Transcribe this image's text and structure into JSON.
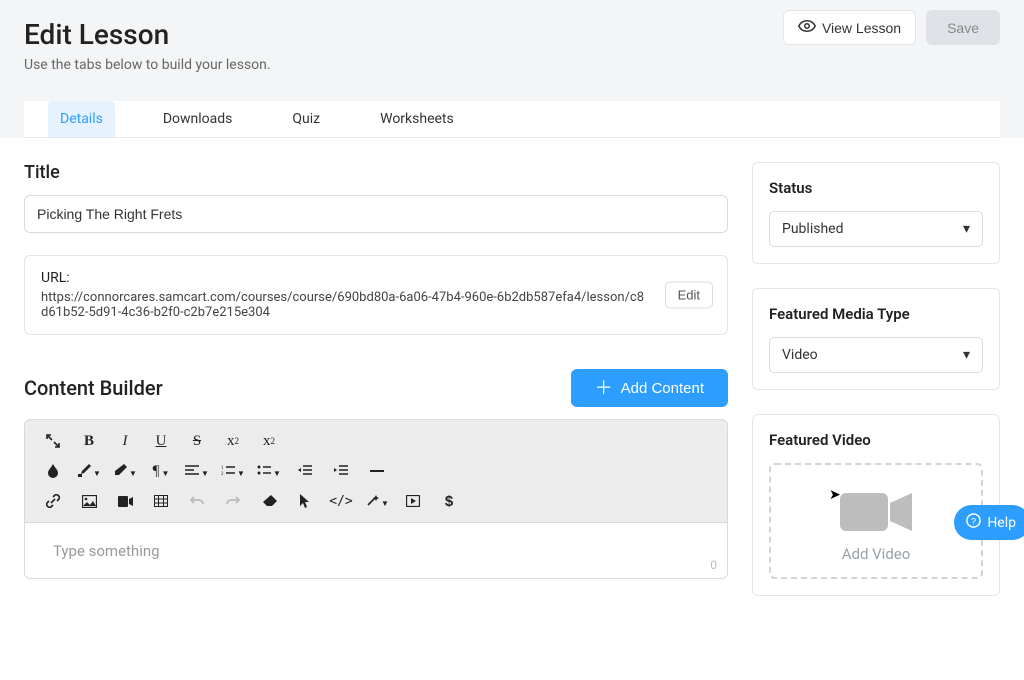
{
  "header": {
    "title": "Edit Lesson",
    "subtitle": "Use the tabs below to build your lesson.",
    "view_label": "View Lesson",
    "save_label": "Save"
  },
  "tabs": {
    "details": "Details",
    "downloads": "Downloads",
    "quiz": "Quiz",
    "worksheets": "Worksheets"
  },
  "title_section": {
    "label": "Title",
    "value": "Picking The Right Frets"
  },
  "url_section": {
    "label": "URL:",
    "value": "https://connorcares.samcart.com/courses/course/690bd80a-6a06-47b4-960e-6b2db587efa4/lesson/c8d61b52-5d91-4c36-b2f0-c2b7e215e304",
    "edit_label": "Edit"
  },
  "builder": {
    "title": "Content Builder",
    "add_label": "Add Content",
    "placeholder": "Type something",
    "char_count": "0"
  },
  "status_card": {
    "title": "Status",
    "selected": "Published"
  },
  "media_card": {
    "title": "Featured Media Type",
    "selected": "Video"
  },
  "video_card": {
    "title": "Featured Video",
    "drop_label": "Add Video"
  },
  "help": {
    "label": "Help"
  },
  "toolbar_icons": {
    "expand": "expand-icon",
    "bold": "bold-icon",
    "italic": "italic-icon",
    "underline": "underline-icon",
    "strike": "strike-icon",
    "sub": "subscript-icon",
    "sup": "superscript-icon",
    "ink": "ink-drop-icon",
    "brush": "brush-icon",
    "eraser-style": "clear-format-icon",
    "paragraph": "paragraph-icon",
    "align": "align-icon",
    "ol": "ordered-list-icon",
    "ul": "unordered-list-icon",
    "outdent": "outdent-icon",
    "indent": "indent-icon",
    "hr": "horizontal-rule-icon",
    "link": "link-icon",
    "image": "image-icon",
    "video": "video-icon",
    "table": "table-icon",
    "undo": "undo-icon",
    "redo": "redo-icon",
    "eraser": "eraser-icon",
    "pointer": "pointer-icon",
    "code": "code-icon",
    "magic": "magic-icon",
    "play": "play-box-icon",
    "dollar": "dollar-icon"
  }
}
